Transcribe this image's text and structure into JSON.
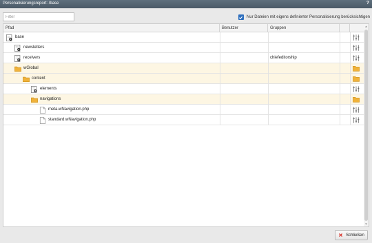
{
  "window": {
    "title": "Personalisierungsreport: /base",
    "help": "?"
  },
  "filter": {
    "placeholder": "Filter",
    "value": ""
  },
  "only_custom": {
    "checked": true,
    "label": "Nur Dateien mit eigens definierter Personalisierung berücksichtigen"
  },
  "columns": {
    "path": "Pfad",
    "users": "Benutzer",
    "groups": "Gruppen"
  },
  "rows": [
    {
      "name": "base",
      "type": "site",
      "level": 0,
      "users": "",
      "groups": "",
      "action_icon": "sliders-icon"
    },
    {
      "name": "newsletters",
      "type": "site",
      "level": 1,
      "users": "",
      "groups": "",
      "action_icon": "sliders-icon"
    },
    {
      "name": "receivers",
      "type": "site",
      "level": 1,
      "users": "",
      "groups": "chiefeditorship",
      "action_icon": "sliders-icon"
    },
    {
      "name": "wGlobal",
      "type": "folder",
      "level": 1,
      "users": "",
      "groups": "",
      "action_icon": "folder-icon"
    },
    {
      "name": "content",
      "type": "folder",
      "level": 2,
      "users": "",
      "groups": "",
      "action_icon": "folder-icon"
    },
    {
      "name": "elements",
      "type": "site",
      "level": 3,
      "users": "",
      "groups": "",
      "action_icon": "sliders-icon"
    },
    {
      "name": "navigations",
      "type": "folder",
      "level": 3,
      "users": "",
      "groups": "",
      "action_icon": "folder-icon"
    },
    {
      "name": "meta.wNavigation.php",
      "type": "file",
      "level": 4,
      "users": "",
      "groups": "",
      "action_icon": "sliders-icon"
    },
    {
      "name": "standard.wNavigation.php",
      "type": "file",
      "level": 4,
      "users": "",
      "groups": "",
      "action_icon": "sliders-icon"
    }
  ],
  "footer": {
    "close_label": "Schließen"
  },
  "colors": {
    "title_bar": "#4f5e6b",
    "folder": "#f0b23a",
    "dir_row": "#fdf6e3",
    "checkbox": "#2e6fbe",
    "close_x": "#d8322a"
  }
}
